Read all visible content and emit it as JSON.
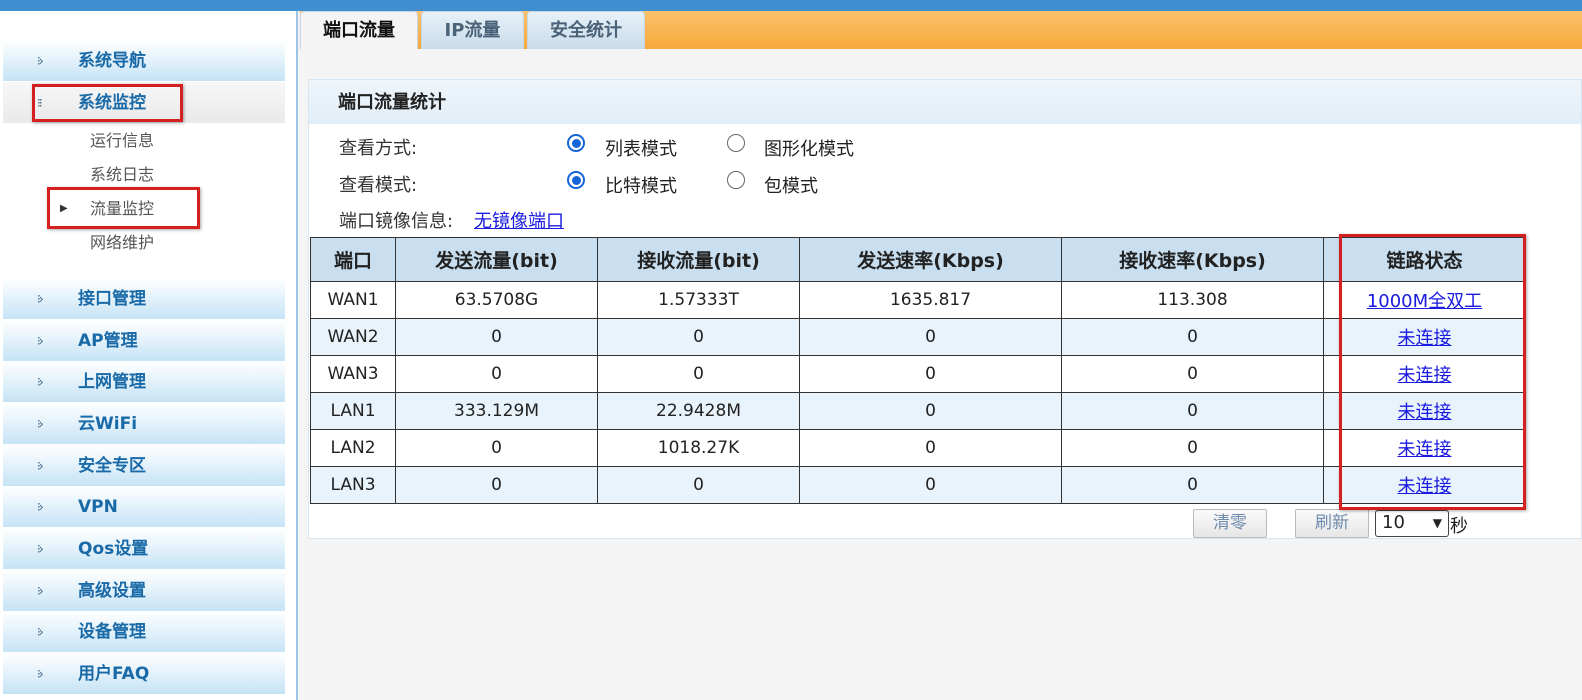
{
  "sidebar": {
    "items": [
      {
        "label": "系统导航",
        "icon": "nav-icon"
      },
      {
        "label": "系统监控",
        "icon": "monitor-icon"
      },
      {
        "label": "接口管理",
        "icon": "nav-icon"
      },
      {
        "label": "AP管理",
        "icon": "nav-icon"
      },
      {
        "label": "上网管理",
        "icon": "nav-icon"
      },
      {
        "label": "云WiFi",
        "icon": "nav-icon"
      },
      {
        "label": "安全专区",
        "icon": "nav-icon"
      },
      {
        "label": "VPN",
        "icon": "nav-icon"
      },
      {
        "label": "Qos设置",
        "icon": "nav-icon"
      },
      {
        "label": "高级设置",
        "icon": "nav-icon"
      },
      {
        "label": "设备管理",
        "icon": "nav-icon"
      },
      {
        "label": "用户FAQ",
        "icon": "nav-icon"
      }
    ],
    "subitems": [
      "运行信息",
      "系统日志",
      "流量监控",
      "网络维护"
    ]
  },
  "tabs": [
    "端口流量",
    "IP流量",
    "安全统计"
  ],
  "panel": {
    "title": "端口流量统计",
    "view_mode_label": "查看方式:",
    "view_mode_options": [
      "列表模式",
      "图形化模式"
    ],
    "view_type_label": "查看模式:",
    "view_type_options": [
      "比特模式",
      "包模式"
    ],
    "mirror_label": "端口镜像信息:",
    "mirror_link": "无镜像端口"
  },
  "table": {
    "headers": [
      "端口",
      "发送流量(bit)",
      "接收流量(bit)",
      "发送速率(Kbps)",
      "接收速率(Kbps)",
      "链路状态"
    ],
    "rows": [
      [
        "WAN1",
        "63.5708G",
        "1.57333T",
        "1635.817",
        "113.308",
        "1000M全双工"
      ],
      [
        "WAN2",
        "0",
        "0",
        "0",
        "0",
        "未连接"
      ],
      [
        "WAN3",
        "0",
        "0",
        "0",
        "0",
        "未连接"
      ],
      [
        "LAN1",
        "333.129M",
        "22.9428M",
        "0",
        "0",
        "未连接"
      ],
      [
        "LAN2",
        "0",
        "1018.27K",
        "0",
        "0",
        "未连接"
      ],
      [
        "LAN3",
        "0",
        "0",
        "0",
        "0",
        "未连接"
      ]
    ]
  },
  "controls": {
    "clear_label": "清零",
    "refresh_label": "刷新",
    "interval_value": "10",
    "interval_unit": "秒"
  },
  "colors": {
    "accent_blue": "#1a6aa8",
    "highlight_red": "#d42020",
    "tab_orange": "#f6a93a"
  }
}
